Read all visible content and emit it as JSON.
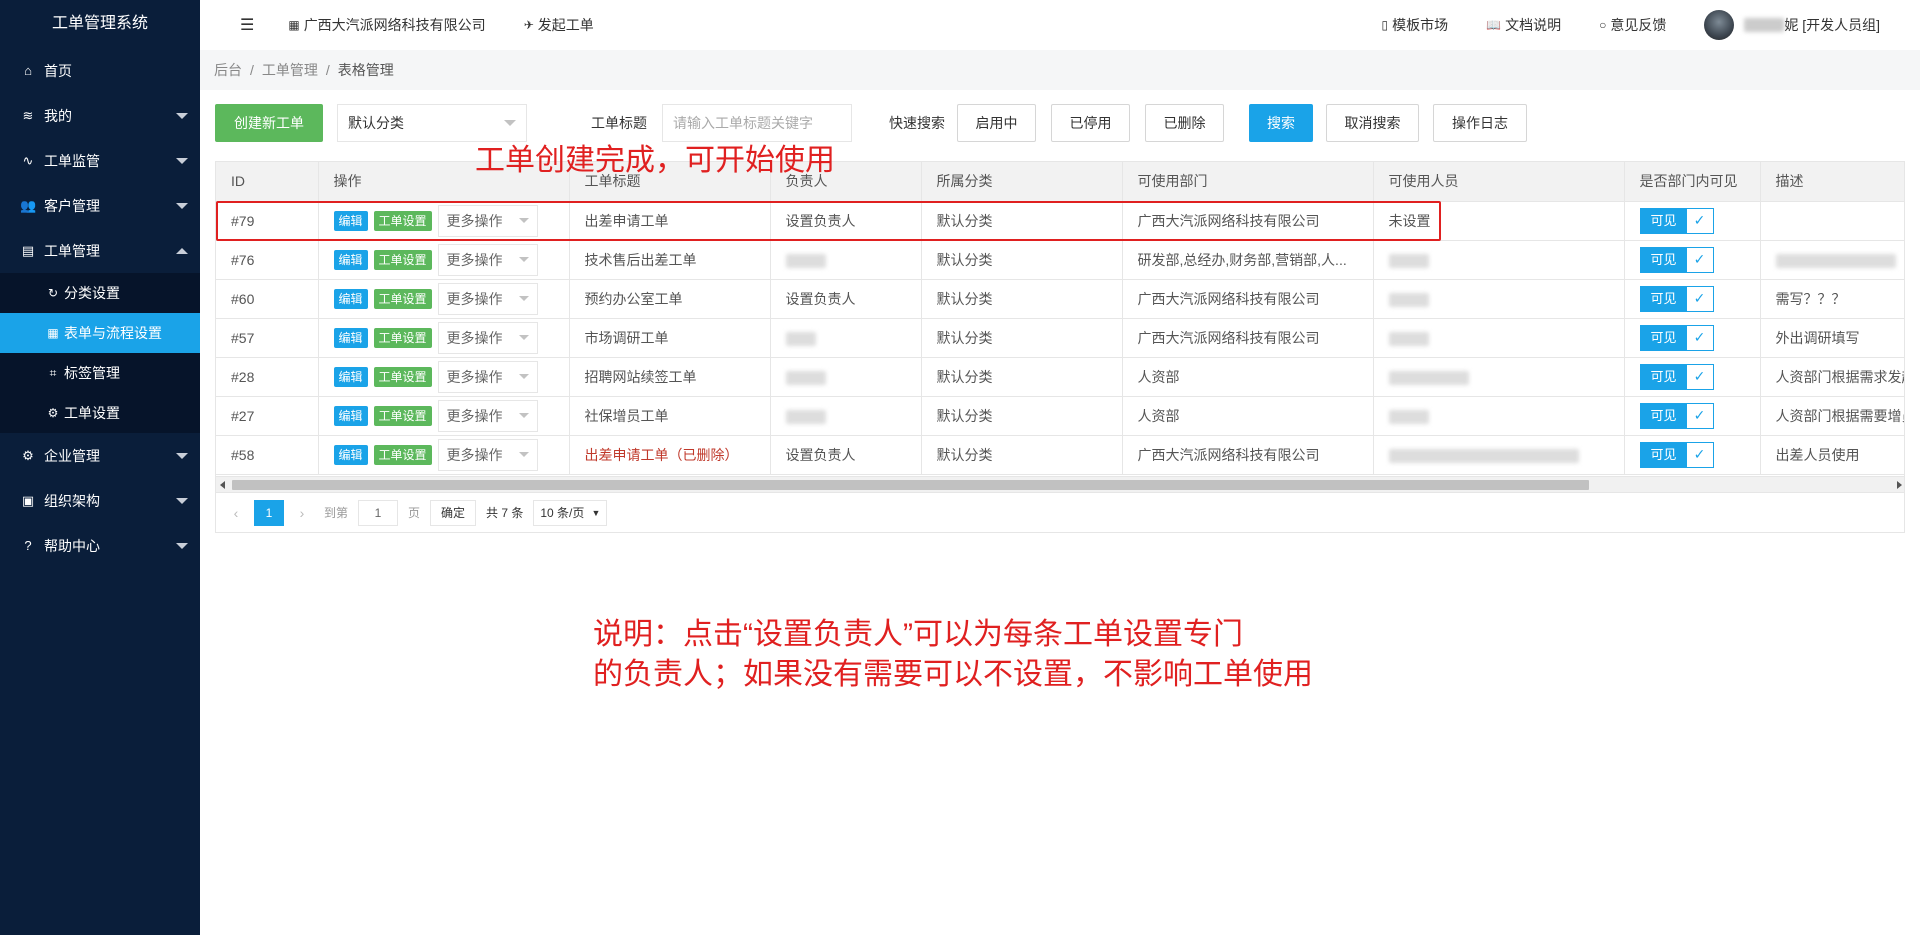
{
  "app": {
    "title": "工单管理系统"
  },
  "sidebar": {
    "items": [
      {
        "label": "首页",
        "icon": "home-icon",
        "arrow": ""
      },
      {
        "label": "我的",
        "icon": "layers-icon",
        "arrow": "down"
      },
      {
        "label": "工单监管",
        "icon": "pulse-icon",
        "arrow": "down"
      },
      {
        "label": "客户管理",
        "icon": "users-icon",
        "arrow": "down"
      },
      {
        "label": "工单管理",
        "icon": "clipboard-icon",
        "arrow": "up"
      }
    ],
    "subitems": [
      {
        "label": "分类设置",
        "icon": "refresh-icon",
        "active": false
      },
      {
        "label": "表单与流程设置",
        "icon": "grid-icon",
        "active": true
      },
      {
        "label": "标签管理",
        "icon": "tag-icon",
        "active": false
      },
      {
        "label": "工单设置",
        "icon": "gear-icon",
        "active": false
      }
    ],
    "items2": [
      {
        "label": "企业管理",
        "icon": "gear-icon",
        "arrow": "down"
      },
      {
        "label": "组织架构",
        "icon": "calendar-icon",
        "arrow": "down"
      },
      {
        "label": "帮助中心",
        "icon": "question-icon",
        "arrow": "down"
      }
    ]
  },
  "topbar": {
    "company": "广西大汽派网络科技有限公司",
    "launch": "发起工单",
    "templates": "模板市场",
    "docs": "文档说明",
    "feedback": "意见反馈",
    "user_suffix": "妮 [开发人员组]"
  },
  "breadcrumb": [
    "后台",
    "工单管理",
    "表格管理"
  ],
  "toolbar": {
    "create": "创建新工单",
    "category_selected": "默认分类",
    "title_label": "工单标题",
    "title_placeholder": "请输入工单标题关键字",
    "quick_label": "快速搜索",
    "quick": [
      "启用中",
      "已停用",
      "已删除"
    ],
    "search": "搜索",
    "cancel_search": "取消搜索",
    "log": "操作日志"
  },
  "table": {
    "headers": [
      "ID",
      "操作",
      "工单标题",
      "负责人",
      "所属分类",
      "可使用部门",
      "可使用人员",
      "是否部门内可见",
      "描述"
    ],
    "edit_label": "编辑",
    "setting_label": "工单设置",
    "more_label": "更多操作",
    "visible_label": "可见",
    "rows": [
      {
        "id": "#79",
        "title": "出差申请工单",
        "owner": "设置负责人",
        "category": "默认分类",
        "dept": "广西大汽派网络科技有限公司",
        "people": "未设置",
        "desc": ""
      },
      {
        "id": "#76",
        "title": "技术售后出差工单",
        "owner": "",
        "category": "默认分类",
        "dept": "研发部,总经办,财务部,营销部,人...",
        "people": "",
        "desc": ""
      },
      {
        "id": "#60",
        "title": "预约办公室工单",
        "owner": "设置负责人",
        "category": "默认分类",
        "dept": "广西大汽派网络科技有限公司",
        "people": "",
        "desc": "需写？？？"
      },
      {
        "id": "#57",
        "title": "市场调研工单",
        "owner": "",
        "category": "默认分类",
        "dept": "广西大汽派网络科技有限公司",
        "people": "",
        "desc": "外出调研填写"
      },
      {
        "id": "#28",
        "title": "招聘网站续签工单",
        "owner": "",
        "category": "默认分类",
        "dept": "人资部",
        "people": "",
        "desc": "人资部门根据需求发起"
      },
      {
        "id": "#27",
        "title": "社保增员工单",
        "owner": "",
        "category": "默认分类",
        "dept": "人资部",
        "people": "",
        "desc": "人资部门根据需要增员"
      },
      {
        "id": "#58",
        "title": "出差申请工单（已删除）",
        "owner": "设置负责人",
        "category": "默认分类",
        "dept": "广西大汽派网络科技有限公司",
        "people": "",
        "desc": "出差人员使用",
        "deleted": true
      }
    ]
  },
  "pager": {
    "current": "1",
    "goto_label": "到第",
    "goto_value": "1",
    "page_unit": "页",
    "confirm": "确定",
    "total": "共 7 条",
    "per_page": "10 条/页"
  },
  "annotations": {
    "title": "工单创建完成，可开始使用",
    "desc_line1": "说明：点击“设置负责人”可以为每条工单设置专门",
    "desc_line2": "的负责人；如果没有需要可以不设置，不影响工单使用"
  },
  "colors": {
    "sidebar": "#0a1e3a",
    "accent": "#1aa3e8",
    "green": "#5cb85c",
    "annotation": "#e02020"
  }
}
